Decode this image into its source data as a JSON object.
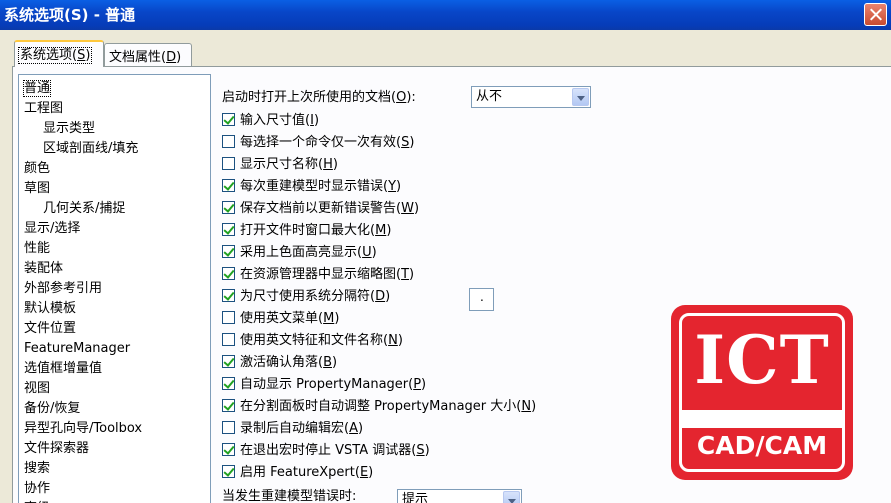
{
  "window": {
    "title": "系统选项(S) - 普通"
  },
  "tabs": [
    {
      "label": "系统选项",
      "mnemonic": "S"
    },
    {
      "label": "文档属性",
      "mnemonic": "D"
    }
  ],
  "tree": [
    "普通",
    "工程图",
    "显示类型",
    "区域剖面线/填充",
    "颜色",
    "草图",
    "几何关系/捕捉",
    "显示/选择",
    "性能",
    "装配体",
    "外部参考引用",
    "默认模板",
    "文件位置",
    "FeatureManager",
    "选值框增量值",
    "视图",
    "备份/恢复",
    "异型孔向导/Toolbox",
    "文件探索器",
    "搜索",
    "协作",
    "高级"
  ],
  "options": {
    "open_last": {
      "label": "启动时打开上次所使用的文档",
      "mnemonic": "O",
      "value": "从不"
    },
    "checks": [
      {
        "label": "输入尺寸值",
        "mnemonic": "I",
        "checked": true
      },
      {
        "label": "每选择一个命令仅一次有效",
        "mnemonic": "S",
        "checked": false
      },
      {
        "label": "显示尺寸名称",
        "mnemonic": "H",
        "checked": false
      },
      {
        "label": "每次重建模型时显示错误",
        "mnemonic": "Y",
        "checked": true
      },
      {
        "label": "保存文档前以更新错误警告",
        "mnemonic": "W",
        "checked": true
      },
      {
        "label": "打开文件时窗口最大化",
        "mnemonic": "M",
        "checked": true
      },
      {
        "label": "采用上色面高亮显示",
        "mnemonic": "U",
        "checked": true
      },
      {
        "label": "在资源管理器中显示缩略图",
        "mnemonic": "T",
        "checked": true
      },
      {
        "label": "为尺寸使用系统分隔符",
        "mnemonic": "D",
        "checked": true
      },
      {
        "label": "使用英文菜单",
        "mnemonic": "M",
        "checked": false
      },
      {
        "label": "使用英文特征和文件名称",
        "mnemonic": "N",
        "checked": false
      },
      {
        "label": "激活确认角落",
        "mnemonic": "B",
        "checked": true
      },
      {
        "label": "自动显示 PropertyManager",
        "mnemonic": "P",
        "checked": true
      },
      {
        "label": "在分割面板时自动调整 PropertyManager 大小",
        "mnemonic": "N",
        "checked": true
      },
      {
        "label": "录制后自动编辑宏",
        "mnemonic": "A",
        "checked": false
      },
      {
        "label": "在退出宏时停止 VSTA 调试器",
        "mnemonic": "S",
        "checked": true
      },
      {
        "label": "启用 FeatureXpert",
        "mnemonic": "E",
        "checked": true
      }
    ],
    "rebuild_error": {
      "label": "当发生重建模型错误时:",
      "value": "提示"
    },
    "separator_value": "."
  },
  "logo": {
    "title": "ICT",
    "subtitle": "CAD/CAM",
    "color": "#e4252f"
  }
}
